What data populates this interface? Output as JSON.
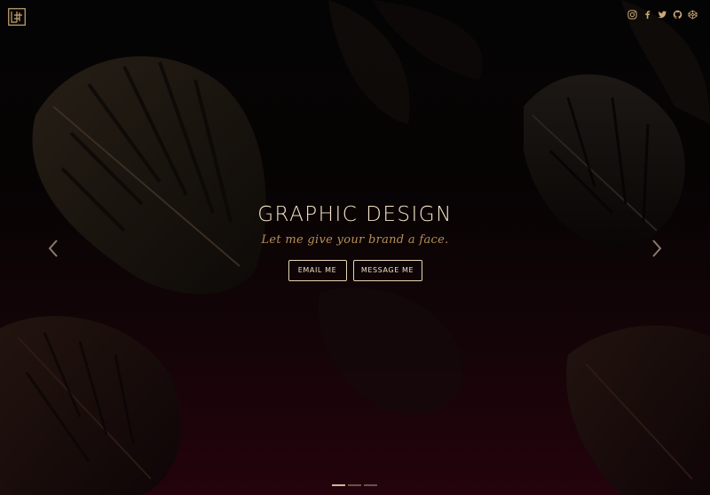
{
  "hero": {
    "title": "GRAPHIC DESIGN",
    "tagline": "Let me give your brand a face."
  },
  "buttons": {
    "email": "EMAIL ME",
    "message": "MESSAGE ME"
  },
  "social": [
    "instagram-icon",
    "facebook-icon",
    "twitter-icon",
    "github-icon",
    "codepen-icon"
  ],
  "carousel": {
    "slide_count": 3,
    "active_index": 0
  },
  "colors": {
    "accent": "#b98f55",
    "title": "#f3e3c6",
    "button_border": "#e8d5b3",
    "background_bottom": "#24030c"
  }
}
